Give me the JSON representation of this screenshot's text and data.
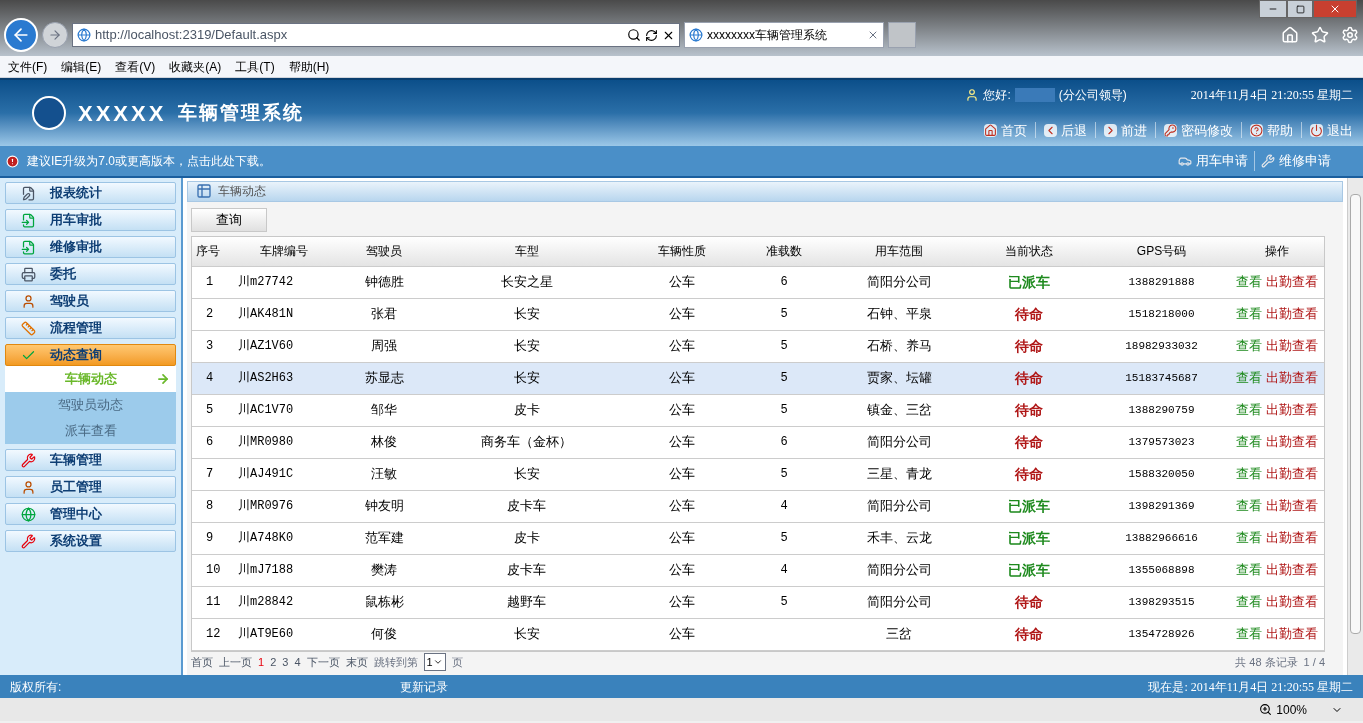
{
  "browser": {
    "url": "http://localhost:2319/Default.aspx",
    "tab_title": "xxxxxxxx车辆管理系统",
    "menu": [
      "文件(F)",
      "编辑(E)",
      "查看(V)",
      "收藏夹(A)",
      "工具(T)",
      "帮助(H)"
    ],
    "zoom": "100%"
  },
  "header": {
    "logo_text": "XXXXX",
    "title": "车辆管理系统",
    "greeting": "您好:",
    "role": "(分公司领导)",
    "datetime": "2014年11月4日 21:20:55 星期二",
    "nav": [
      {
        "label": "首页",
        "kind": "home"
      },
      {
        "label": "后退",
        "kind": "back"
      },
      {
        "label": "前进",
        "kind": "forward"
      },
      {
        "label": "密码修改",
        "kind": "password"
      },
      {
        "label": "帮助",
        "kind": "help"
      },
      {
        "label": "退出",
        "kind": "exit"
      }
    ],
    "notice": "建议IE升级为7.0或更高版本，点击此处下载。",
    "quick_links": [
      {
        "label": "用车申请",
        "kind": "car"
      },
      {
        "label": "维修申请",
        "kind": "tools"
      }
    ]
  },
  "sidebar": {
    "items": [
      {
        "label": "报表统计",
        "kind": "report",
        "selected": false
      },
      {
        "label": "用车审批",
        "kind": "approve",
        "selected": false
      },
      {
        "label": "维修审批",
        "kind": "approve",
        "selected": false
      },
      {
        "label": "委托",
        "kind": "print",
        "selected": false
      },
      {
        "label": "驾驶员",
        "kind": "person",
        "selected": false
      },
      {
        "label": "流程管理",
        "kind": "ruler",
        "selected": false
      },
      {
        "label": "动态查询",
        "kind": "check",
        "selected": true,
        "children": [
          {
            "label": "车辆动态",
            "selected": true
          },
          {
            "label": "驾驶员动态",
            "selected": false
          },
          {
            "label": "派车查看",
            "selected": false
          }
        ]
      },
      {
        "label": "车辆管理",
        "kind": "tools",
        "selected": false
      },
      {
        "label": "员工管理",
        "kind": "person",
        "selected": false
      },
      {
        "label": "管理中心",
        "kind": "globe",
        "selected": false
      },
      {
        "label": "系统设置",
        "kind": "tools",
        "selected": false
      }
    ]
  },
  "content": {
    "title": "车辆动态",
    "query_button": "查询",
    "columns": [
      "序号",
      "车牌编号",
      "驾驶员",
      "车型",
      "车辆性质",
      "准载数",
      "用车范围",
      "当前状态",
      "GPS号码",
      "操作"
    ],
    "rows": [
      {
        "no": "1",
        "plate": "川m27742",
        "driver": "钟德胜",
        "type": "长安之星",
        "nature": "公车",
        "seats": "6",
        "scope": "简阳分公司",
        "status": {
          "label": "已派车",
          "color": "#1e8a1e"
        },
        "gps": "1388291888",
        "actions": [
          "查看",
          "出勤查看"
        ],
        "selected": false
      },
      {
        "no": "2",
        "plate": "川AK481N",
        "driver": "张君",
        "type": "长安",
        "nature": "公车",
        "seats": "5",
        "scope": "石钟、平泉",
        "status": {
          "label": "待命",
          "color": "#b01818"
        },
        "gps": "1518218000",
        "actions": [
          "查看",
          "出勤查看"
        ],
        "selected": false
      },
      {
        "no": "3",
        "plate": "川AZ1V60",
        "driver": "周强",
        "type": "长安",
        "nature": "公车",
        "seats": "5",
        "scope": "石桥、养马",
        "status": {
          "label": "待命",
          "color": "#b01818"
        },
        "gps": "18982933032",
        "actions": [
          "查看",
          "出勤查看"
        ],
        "selected": false
      },
      {
        "no": "4",
        "plate": "川AS2H63",
        "driver": "苏显志",
        "type": "长安",
        "nature": "公车",
        "seats": "5",
        "scope": "贾家、坛罐",
        "status": {
          "label": "待命",
          "color": "#b01818"
        },
        "gps": "15183745687",
        "actions": [
          "查看",
          "出勤查看"
        ],
        "selected": true
      },
      {
        "no": "5",
        "plate": "川AC1V70",
        "driver": "邹华",
        "type": "皮卡",
        "nature": "公车",
        "seats": "5",
        "scope": "镇金、三岔",
        "status": {
          "label": "待命",
          "color": "#b01818"
        },
        "gps": "1388290759",
        "actions": [
          "查看",
          "出勤查看"
        ],
        "selected": false
      },
      {
        "no": "6",
        "plate": "川MR0980",
        "driver": "林俊",
        "type": "商务车（金杯）",
        "nature": "公车",
        "seats": "6",
        "scope": "简阳分公司",
        "status": {
          "label": "待命",
          "color": "#b01818"
        },
        "gps": "1379573023",
        "actions": [
          "查看",
          "出勤查看"
        ],
        "selected": false
      },
      {
        "no": "7",
        "plate": "川AJ491C",
        "driver": "汪敏",
        "type": "长安",
        "nature": "公车",
        "seats": "5",
        "scope": "三星、青龙",
        "status": {
          "label": "待命",
          "color": "#b01818"
        },
        "gps": "1588320050",
        "actions": [
          "查看",
          "出勤查看"
        ],
        "selected": false
      },
      {
        "no": "8",
        "plate": "川MR0976",
        "driver": "钟友明",
        "type": "皮卡车",
        "nature": "公车",
        "seats": "4",
        "scope": "简阳分公司",
        "status": {
          "label": "已派车",
          "color": "#1e8a1e"
        },
        "gps": "1398291369",
        "actions": [
          "查看",
          "出勤查看"
        ],
        "selected": false
      },
      {
        "no": "9",
        "plate": "川A748K0",
        "driver": "范军建",
        "type": "皮卡",
        "nature": "公车",
        "seats": "5",
        "scope": "禾丰、云龙",
        "status": {
          "label": "已派车",
          "color": "#1e8a1e"
        },
        "gps": "13882966616",
        "actions": [
          "查看",
          "出勤查看"
        ],
        "selected": false
      },
      {
        "no": "10",
        "plate": "川mJ7188",
        "driver": "樊涛",
        "type": "皮卡车",
        "nature": "公车",
        "seats": "4",
        "scope": "简阳分公司",
        "status": {
          "label": "已派车",
          "color": "#1e8a1e"
        },
        "gps": "1355068898",
        "actions": [
          "查看",
          "出勤查看"
        ],
        "selected": false
      },
      {
        "no": "11",
        "plate": "川m28842",
        "driver": "鼠栋彬",
        "type": "越野车",
        "nature": "公车",
        "seats": "5",
        "scope": "简阳分公司",
        "status": {
          "label": "待命",
          "color": "#b01818"
        },
        "gps": "1398293515",
        "actions": [
          "查看",
          "出勤查看"
        ],
        "selected": false
      },
      {
        "no": "12",
        "plate": "川AT9E60",
        "driver": "何俊",
        "type": "长安",
        "nature": "公车",
        "scope": "三岔",
        "status": {
          "label": "待命",
          "color": "#b01818"
        },
        "gps": "1354728926",
        "actions": [
          "查看",
          "出勤查看"
        ],
        "selected": false
      }
    ],
    "pager": {
      "links": [
        {
          "label": "首页",
          "selected": false
        },
        {
          "label": "上一页",
          "selected": false
        },
        {
          "label": "1",
          "selected": true
        },
        {
          "label": "2",
          "selected": false
        },
        {
          "label": "3",
          "selected": false
        },
        {
          "label": "4",
          "selected": false
        },
        {
          "label": "下一页",
          "selected": false
        },
        {
          "label": "末页",
          "selected": false
        }
      ],
      "jump_label": "跳转到第",
      "jump_value": "1",
      "jump_suffix": "页",
      "total": "共 48 条记录",
      "page_info": "1 / 4"
    }
  },
  "footer": {
    "copyright": "版权所有:",
    "link": "更新记录",
    "now": "现在是: 2014年11月4日 21:20:55 星期二"
  }
}
